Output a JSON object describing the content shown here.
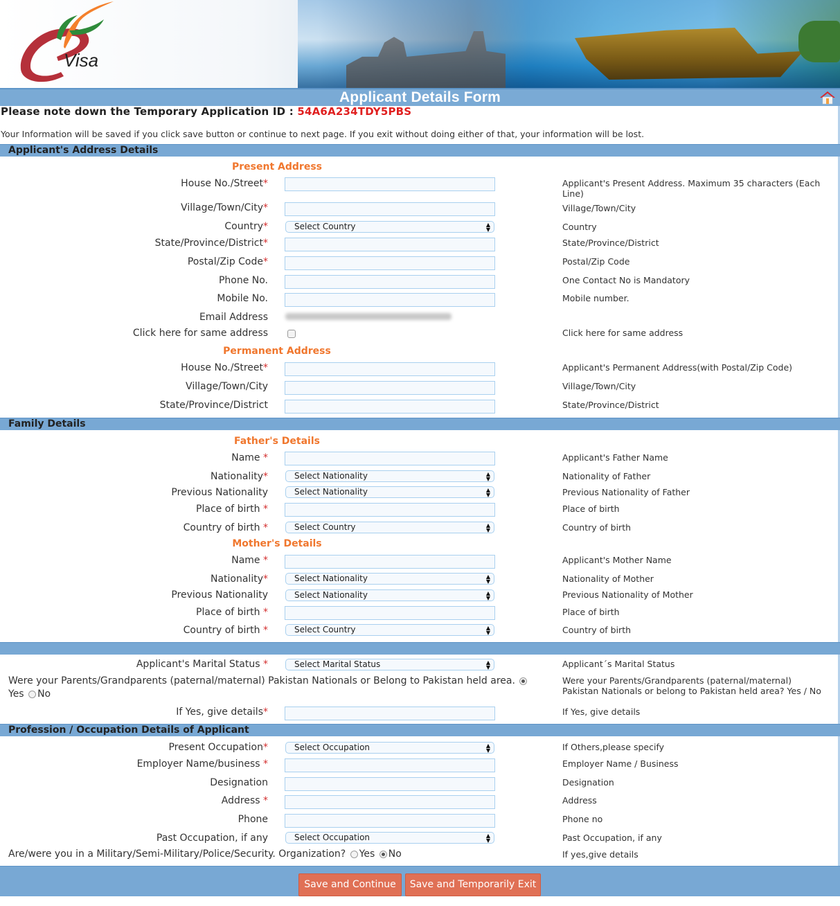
{
  "header": {
    "logo_text": "Visa",
    "form_title": "Applicant Details Form"
  },
  "notice": {
    "temp_id_label": "Please note down the Temporary Application ID :",
    "temp_id_value": "54A6A234TDY5PBS",
    "info": "Your Information will be saved if you click save button or continue to next page. If you exit without doing either of that, your information will be lost."
  },
  "sections": {
    "address": "Applicant's Address Details",
    "family": "Family Details",
    "profession": "Profession / Occupation Details of Applicant"
  },
  "present_address": {
    "heading": "Present Address",
    "house_label": "House No./Street",
    "house_hint": "Applicant's Present Address. Maximum 35 characters (Each Line)",
    "city_label": "Village/Town/City",
    "city_hint": "Village/Town/City",
    "country_label": "Country",
    "country_value": "Select Country",
    "country_hint": "Country",
    "state_label": "State/Province/District",
    "state_hint": "State/Province/District",
    "postal_label": "Postal/Zip Code",
    "postal_hint": "Postal/Zip Code",
    "phone_label": "Phone No.",
    "phone_hint": "One Contact No is Mandatory",
    "mobile_label": "Mobile No.",
    "mobile_hint": "Mobile number.",
    "email_label": "Email Address",
    "same_label": "Click here for same address",
    "same_hint": "Click here for same address",
    "same_checked": false
  },
  "permanent_address": {
    "heading": "Permanent Address",
    "house_label": "House No./Street",
    "house_hint": "Applicant's Permanent Address(with Postal/Zip Code)",
    "city_label": "Village/Town/City",
    "city_hint": "Village/Town/City",
    "state_label": "State/Province/District",
    "state_hint": "State/Province/District"
  },
  "father": {
    "heading": "Father's Details",
    "name_label": "Name ",
    "name_hint": "Applicant's Father Name",
    "nationality_label": "Nationality",
    "nationality_value": "Select Nationality",
    "nationality_hint": "Nationality of Father",
    "prev_nationality_label": "Previous Nationality",
    "prev_nationality_value": "Select Nationality",
    "prev_nationality_hint": "Previous Nationality of Father",
    "pob_label": "Place of birth ",
    "pob_hint": "Place of birth",
    "cob_label": "Country of birth ",
    "cob_value": "Select Country",
    "cob_hint": "Country of birth"
  },
  "mother": {
    "heading": "Mother's Details",
    "name_label": "Name ",
    "name_hint": "Applicant's Mother Name",
    "nationality_label": "Nationality",
    "nationality_value": "Select Nationality",
    "nationality_hint": "Nationality of Mother",
    "prev_nationality_label": "Previous Nationality",
    "prev_nationality_value": "Select Nationality",
    "prev_nationality_hint": "Previous Nationality of Mother",
    "pob_label": "Place of birth ",
    "pob_hint": "Place of birth",
    "cob_label": "Country of birth ",
    "cob_value": "Select Country",
    "cob_hint": "Country of birth"
  },
  "marital": {
    "label": "Applicant's Marital Status ",
    "value": "Select Marital Status",
    "hint": "Applicant´s Marital Status"
  },
  "pakistan": {
    "question": "Were your Parents/Grandparents (paternal/maternal) Pakistan Nationals or Belong to Pakistan held area.",
    "yes_label": "Yes",
    "no_label": "No",
    "selected": "Yes",
    "hint": "Were your Parents/Grandparents (paternal/maternal) Pakistan Nationals or belong to Pakistan held area? Yes / No",
    "details_label": "If Yes, give details",
    "details_hint": "If Yes, give details"
  },
  "profession": {
    "present_label": "Present Occupation",
    "present_value": "Select Occupation",
    "present_hint": "If Others,please specify",
    "employer_label": "Employer Name/business ",
    "employer_hint": "Employer Name / Business",
    "designation_label": "Designation",
    "designation_hint": "Designation",
    "address_label": "Address ",
    "address_hint": "Address",
    "phone_label": "Phone",
    "phone_hint": "Phone no",
    "past_label": "Past Occupation, if any",
    "past_value": "Select Occupation",
    "past_hint": "Past Occupation, if any",
    "military_question": "Are/were you in a Military/Semi-Military/Police/Security. Organization?",
    "military_yes": "Yes",
    "military_no": "No",
    "military_selected": "No",
    "military_hint": "If yes,give details"
  },
  "required_mark": "*",
  "buttons": {
    "save_continue": "Save and Continue",
    "save_exit": "Save and Temporarily Exit"
  },
  "colors": {
    "accent_bar": "#78a8d4",
    "subheading": "#f0772e",
    "temp_id": "#e02020",
    "button": "#e07055"
  }
}
